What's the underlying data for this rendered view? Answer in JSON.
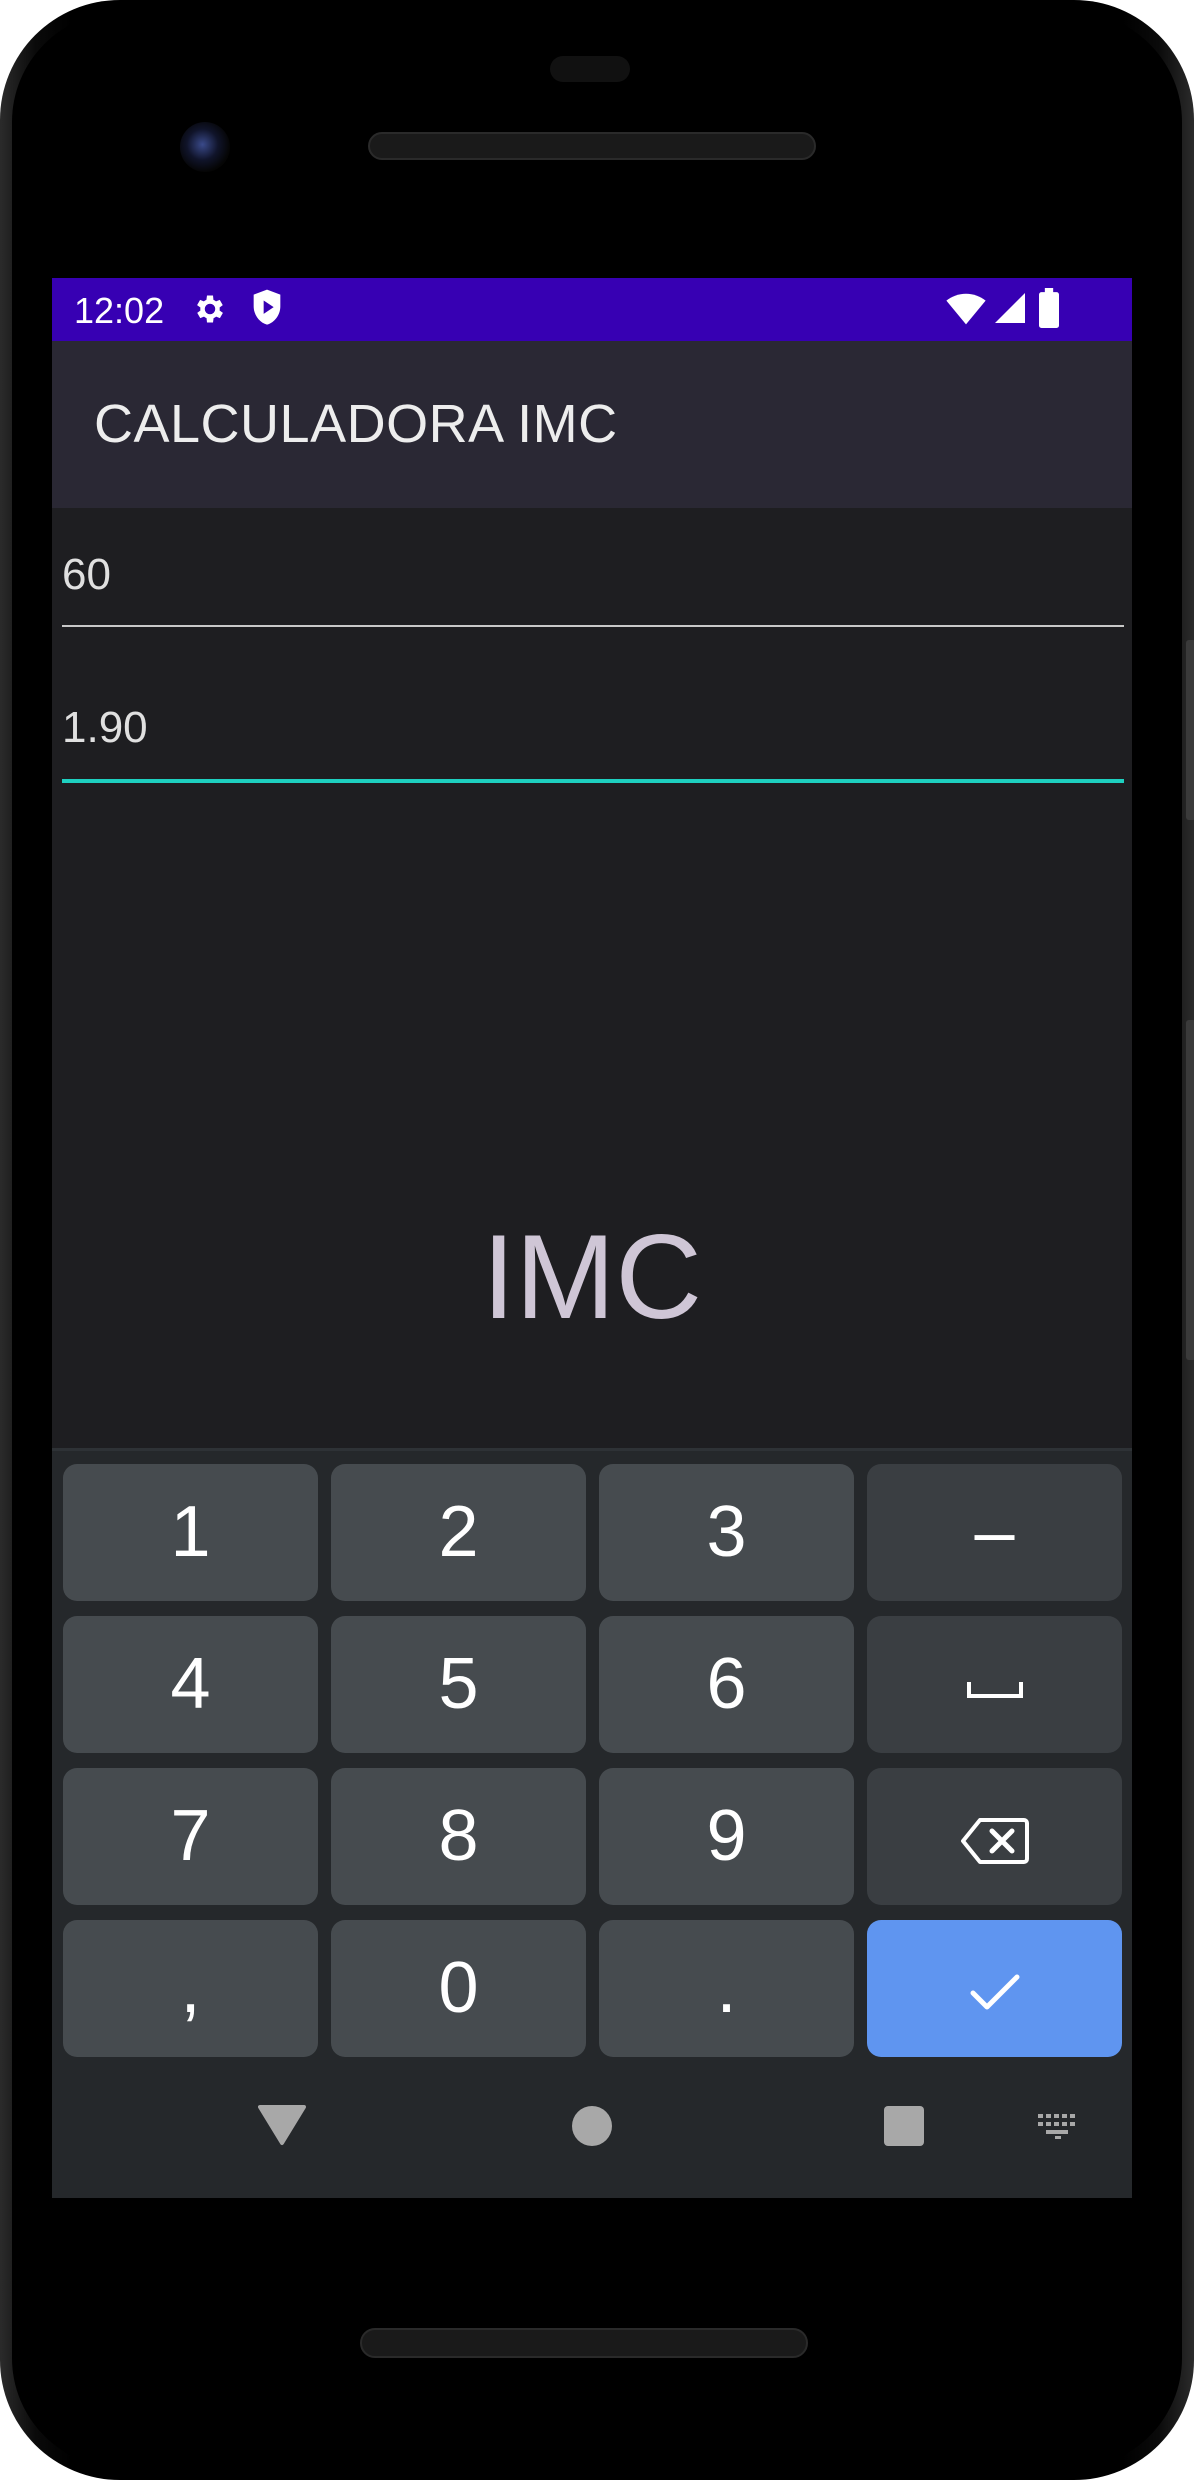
{
  "status_bar": {
    "time": "12:02",
    "icons": [
      "gear-icon",
      "shield-play-icon",
      "wifi-icon",
      "cell-signal-icon",
      "battery-icon"
    ],
    "color": "#3700b3"
  },
  "app_bar": {
    "title": "CALCULADORA IMC",
    "color": "#2a2834"
  },
  "form": {
    "weight_value": "60",
    "height_value": "1.90",
    "focus_color": "#1de9b6"
  },
  "result": {
    "label": "IMC"
  },
  "keyboard": {
    "keys": {
      "k1": "1",
      "k2": "2",
      "k3": "3",
      "minus": "–",
      "k4": "4",
      "k5": "5",
      "k6": "6",
      "k7": "7",
      "k8": "8",
      "k9": "9",
      "comma": ",",
      "k0": "0",
      "period": "."
    },
    "special_icons": [
      "space-icon",
      "backspace-icon",
      "checkmark-icon"
    ],
    "enter_color": "#5f95f0"
  },
  "nav_bar": {
    "icons": [
      "back-triangle-icon",
      "home-circle-icon",
      "recents-square-icon",
      "keyboard-switch-icon"
    ]
  }
}
